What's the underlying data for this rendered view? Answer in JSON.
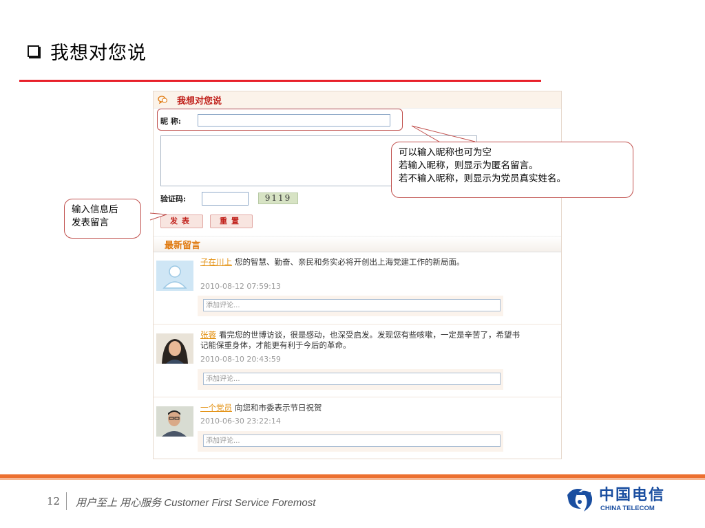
{
  "slide": {
    "title": "我想对您说"
  },
  "form": {
    "panel_title": "我想对您说",
    "nickname_label": "昵 称:",
    "captcha_label": "验证码:",
    "captcha_code": "9119",
    "submit_label": "发表",
    "reset_label": "重置"
  },
  "latest": {
    "title": "最新留言",
    "comments": [
      {
        "author": "子在川上",
        "text": "您的智慧、勤奋、亲民和务实必将开创出上海党建工作的新局面。",
        "time": "2010-08-12 07:59:13",
        "reply_placeholder": "添加评论..."
      },
      {
        "author": "张蓉",
        "text": "看完您的世博访谈，很是感动，也深受启发。发现您有些咳嗽，一定是辛苦了，希望书记能保重身体，才能更有利于今后的革命。",
        "time": "2010-08-10 20:43:59",
        "reply_placeholder": "添加评论..."
      },
      {
        "author": "一个党员",
        "text": "向您和市委表示节日祝贺",
        "time": "2010-06-30 23:22:14",
        "reply_placeholder": "添加评论..."
      }
    ]
  },
  "callouts": {
    "left_line1": "输入信息后",
    "left_line2": "发表留言",
    "right_line1": "可以输入昵称也可为空",
    "right_line2": "若输入昵称，则显示为匿名留言。",
    "right_line3": "若不输入昵称，则显示为党员真实姓名。"
  },
  "footer": {
    "page_number": "12",
    "slogan": "用户至上 用心服务 Customer First Service Foremost",
    "logo_cn": "中国电信",
    "logo_en": "CHINA TELECOM"
  },
  "colors": {
    "accent_red": "#e8202a",
    "brand_orange": "#ec7030",
    "link_orange": "#e39010",
    "telecom_blue": "#1a4ea0"
  }
}
